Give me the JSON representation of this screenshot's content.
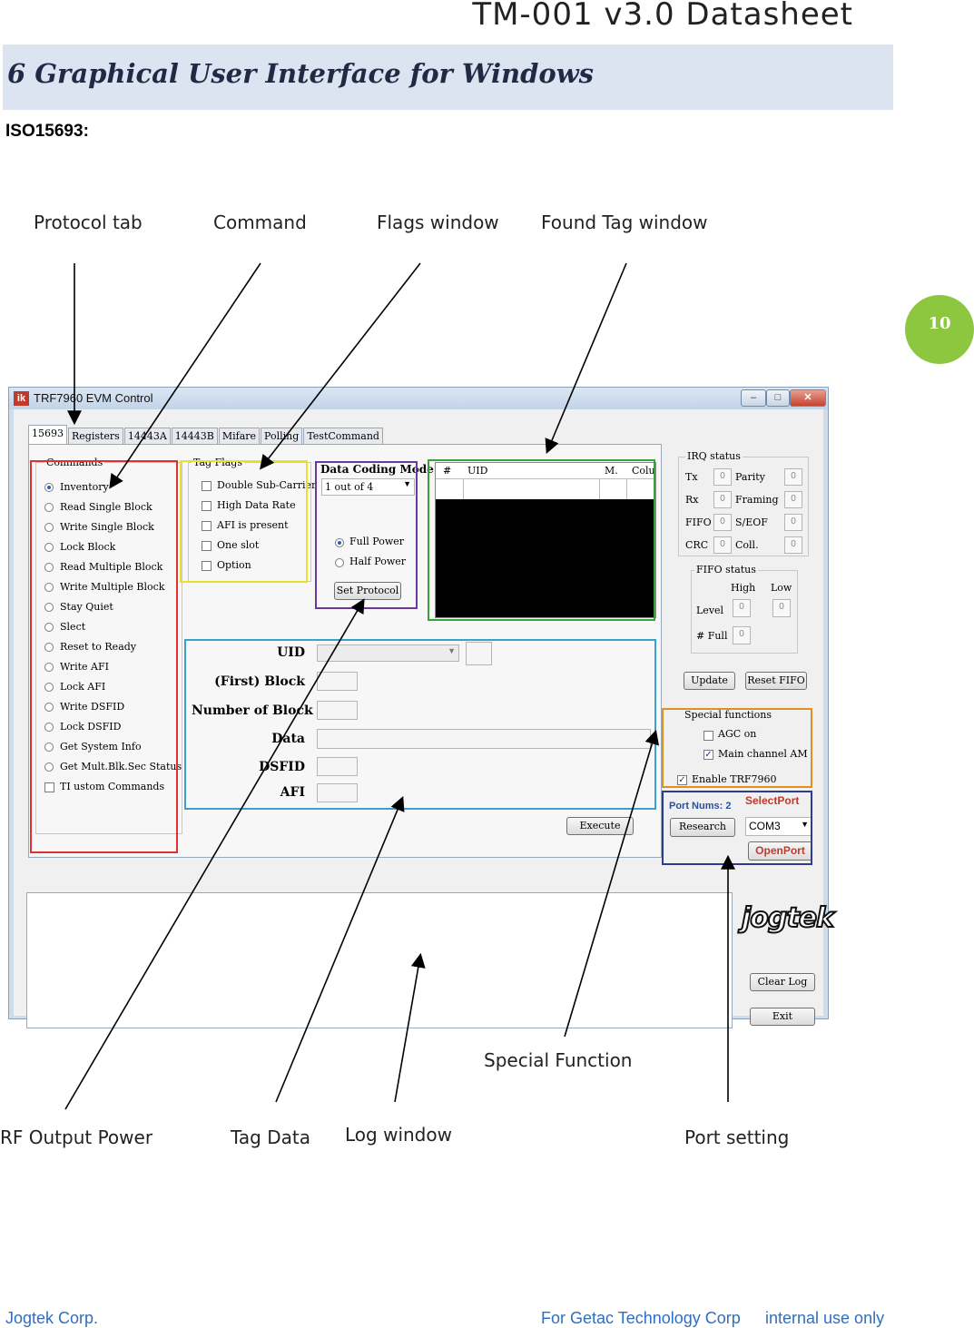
{
  "header": {
    "doc_title": "TM-001  v3.0  Datasheet"
  },
  "section": {
    "title": "6 Graphical User Interface for Windows",
    "subtitle": "ISO15693:"
  },
  "page_number": "10",
  "callouts": {
    "protocol_tab": "Protocol tab",
    "command": "Command",
    "flags_window": "Flags window",
    "found_tag_window": "Found Tag window",
    "special_function": "Special Function",
    "rf_output_power": "RF Output Power",
    "tag_data": "Tag Data",
    "log_window": "Log window",
    "port_setting": "Port setting"
  },
  "window": {
    "title": "TRF7960 EVM Control",
    "app_icon": "ik",
    "controls": {
      "minimize": "–",
      "maximize": "□",
      "close": "✕"
    },
    "tabs": [
      "15693",
      "Registers",
      "14443A",
      "14443B",
      "Mifare",
      "Polling",
      "TestCommand"
    ],
    "commands": {
      "label": "Commands",
      "items": [
        "Inventory",
        "Read Single Block",
        "Write Single Block",
        "Lock Block",
        "Read Multiple Block",
        "Write Multiple Block",
        "Stay Quiet",
        "Slect",
        "Reset to Ready",
        "Write AFI",
        "Lock AFI",
        "Write DSFID",
        "Lock DSFID",
        "Get System Info",
        "Get Mult.Blk.Sec Status"
      ],
      "custom_checkbox": "TI ustom Commands",
      "selected": "Inventory"
    },
    "tag_flags": {
      "label": "Tag Flags",
      "items": [
        "Double Sub-Carrier",
        "High Data Rate",
        "AFI is present",
        "One slot",
        "Option"
      ]
    },
    "data_coding": {
      "label": "Data Coding Mode",
      "value": "1 out of 4",
      "power_options": [
        "Full Power",
        "Half Power"
      ],
      "selected_power": "Full Power",
      "set_protocol": "Set Protocol"
    },
    "found_tags": {
      "columns": [
        "#",
        "UID",
        "M.",
        "Colu"
      ]
    },
    "tag_data": {
      "labels": [
        "UID",
        "(First) Block",
        "Number of Block",
        "Data",
        "DSFID",
        "AFI"
      ],
      "execute": "Execute"
    },
    "irq_status": {
      "label": "IRQ status",
      "rows": [
        {
          "left": "Tx",
          "left_val": "0",
          "right": "Parity",
          "right_val": "0"
        },
        {
          "left": "Rx",
          "left_val": "0",
          "right": "Framing",
          "right_val": "0"
        },
        {
          "left": "FIFO",
          "left_val": "0",
          "right": "S/EOF",
          "right_val": "0"
        },
        {
          "left": "CRC",
          "left_val": "0",
          "right": "Coll.",
          "right_val": "0"
        }
      ]
    },
    "fifo_status": {
      "label": "FIFO status",
      "high": "High",
      "low": "Low",
      "level": "Level",
      "level_high": "0",
      "level_low": "0",
      "full": "# Full",
      "full_val": "0"
    },
    "buttons": {
      "update": "Update",
      "reset_fifo": "Reset FIFO",
      "clear_log": "Clear Log",
      "exit": "Exit"
    },
    "special_functions": {
      "label": "Special functions",
      "agc": "AGC on",
      "agc_checked": false,
      "main_channel": "Main channel AM",
      "main_channel_checked": true,
      "enable": "Enable TRF7960",
      "enable_checked": true
    },
    "port": {
      "nums": "Port Nums: 2",
      "select_label": "SelectPort",
      "research": "Research",
      "com": "COM3",
      "open": "OpenPort"
    },
    "logo": "jogtek"
  },
  "footer": {
    "left": "Jogtek Corp.",
    "middle": "For Getac Technology Corp",
    "right": "internal use only"
  },
  "colors": {
    "commands_box": "#e03030",
    "flags_box": "#e8e030",
    "coding_box": "#6a3a9a",
    "found_box": "#3aa03a",
    "tagdata_box": "#3aa0d0",
    "special_box": "#e09020",
    "port_box": "#303a90",
    "badge": "#8dc63f"
  }
}
